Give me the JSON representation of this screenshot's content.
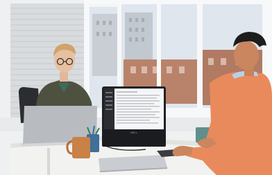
{
  "scene": {
    "description_free": true,
    "palette": {
      "wall": "#eef0f2",
      "window_frame": "#f4f5f6",
      "sky": "#dfe6ee",
      "brick": "#b9826a",
      "desk": "#f2f2f0",
      "monitor_bezel": "#1f2124",
      "screen": "#f5f6f7",
      "sidebar": "#2b2d31",
      "orange_sweater": "#e98a5d",
      "olive_jacket": "#4f5140",
      "laptop_silver": "#c9ccd0",
      "mug_copper": "#c98146",
      "mug_teal": "#5f8f8c",
      "cup_blue": "#3f6f9a"
    },
    "monitor_brand": "DELL"
  }
}
